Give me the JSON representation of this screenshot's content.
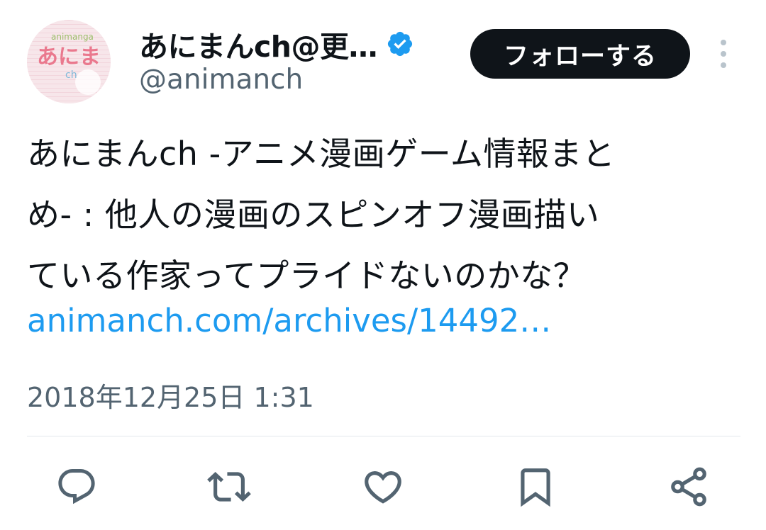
{
  "user": {
    "display_name": "あにまんch@更…",
    "handle": "@animanch",
    "verified": true,
    "avatar_icon": "avatar-logo-icon",
    "verified_color": "#1d9bf0"
  },
  "follow_button": {
    "label": "フォローする"
  },
  "tweet": {
    "text_lines": [
      "あにまんch -アニメ漫画ゲーム情報まと",
      "め- : 他人の漫画のスピンオフ漫画描い",
      "ている作家ってプライドないのかな？"
    ],
    "link": "animanch.com/archives/14492…",
    "timestamp": "2018年12月25日 1:31"
  },
  "actions": [
    {
      "name": "reply",
      "icon": "reply-icon"
    },
    {
      "name": "retweet",
      "icon": "retweet-icon"
    },
    {
      "name": "like",
      "icon": "heart-icon"
    },
    {
      "name": "bookmark",
      "icon": "bookmark-icon"
    },
    {
      "name": "share",
      "icon": "share-icon"
    }
  ],
  "colors": {
    "link": "#1d9bf0",
    "secondary_text": "#536471",
    "primary_text": "#0f1419",
    "action_icon": "#536471"
  }
}
